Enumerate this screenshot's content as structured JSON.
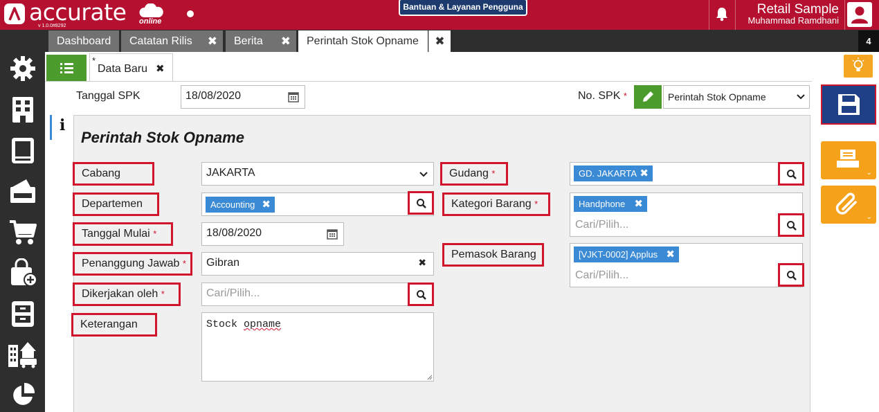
{
  "header": {
    "logo_text": "accurate",
    "logo_suffix": "online",
    "version": "v 1.0.0#8292",
    "help_label": "Bantuan & Layanan Pengguna",
    "company": "Retail Sample",
    "user": "Muhammad Ramdhani"
  },
  "sidebar": {
    "items": [
      "gear-icon",
      "building-icon",
      "ledger-icon",
      "wallet-icon",
      "cart-icon",
      "shopping-bag-icon",
      "cabinet-icon",
      "assets-icon",
      "pie-chart-icon"
    ]
  },
  "tabs": [
    {
      "label": "Dashboard",
      "closable": false
    },
    {
      "label": "Catatan Rilis",
      "closable": true
    },
    {
      "label": "Berita",
      "closable": true
    },
    {
      "label": "Perintah Stok Opname",
      "closable": true,
      "active": true
    }
  ],
  "tab_close": "✖",
  "tab_count": "4",
  "subtab": {
    "dirty_marker": "*",
    "label": "Data Baru",
    "close": "✖"
  },
  "top_fields": {
    "tanggal_spk_label": "Tanggal SPK",
    "tanggal_spk_value": "18/08/2020",
    "no_spk_label": "No. SPK",
    "no_spk_required": "*",
    "no_spk_value": "Perintah Stok Opname"
  },
  "info_tab": "i",
  "form": {
    "title": "Perintah Stok Opname",
    "required_mark": "*",
    "cabang": {
      "label": "Cabang",
      "value": "JAKARTA"
    },
    "departemen": {
      "label": "Departemen",
      "chip": "Accounting"
    },
    "tanggal_mulai": {
      "label": "Tanggal Mulai",
      "value": "18/08/2020"
    },
    "penanggung_jawab": {
      "label": "Penanggung Jawab",
      "value": "Gibran",
      "clear": "✖"
    },
    "dikerjakan_oleh": {
      "label": "Dikerjakan oleh",
      "placeholder": "Cari/Pilih..."
    },
    "keterangan": {
      "label": "Keterangan",
      "value_prefix": "Stock ",
      "value_misspelled": "opname"
    },
    "gudang": {
      "label": "Gudang",
      "chip": "GD. JAKARTA"
    },
    "kategori_barang": {
      "label": "Kategori Barang",
      "chip": "Handphone",
      "placeholder": "Cari/Pilih..."
    },
    "pemasok_barang": {
      "label": "Pemasok Barang",
      "chip": "[VJKT-0002] Applus",
      "placeholder": "Cari/Pilih..."
    }
  },
  "colors": {
    "brand_red": "#b5102f",
    "highlight_red": "#d0142c",
    "chip_blue": "#3a8ad6",
    "save_blue": "#1f3f86",
    "orange": "#f5a11a",
    "green": "#4b9c2c"
  }
}
